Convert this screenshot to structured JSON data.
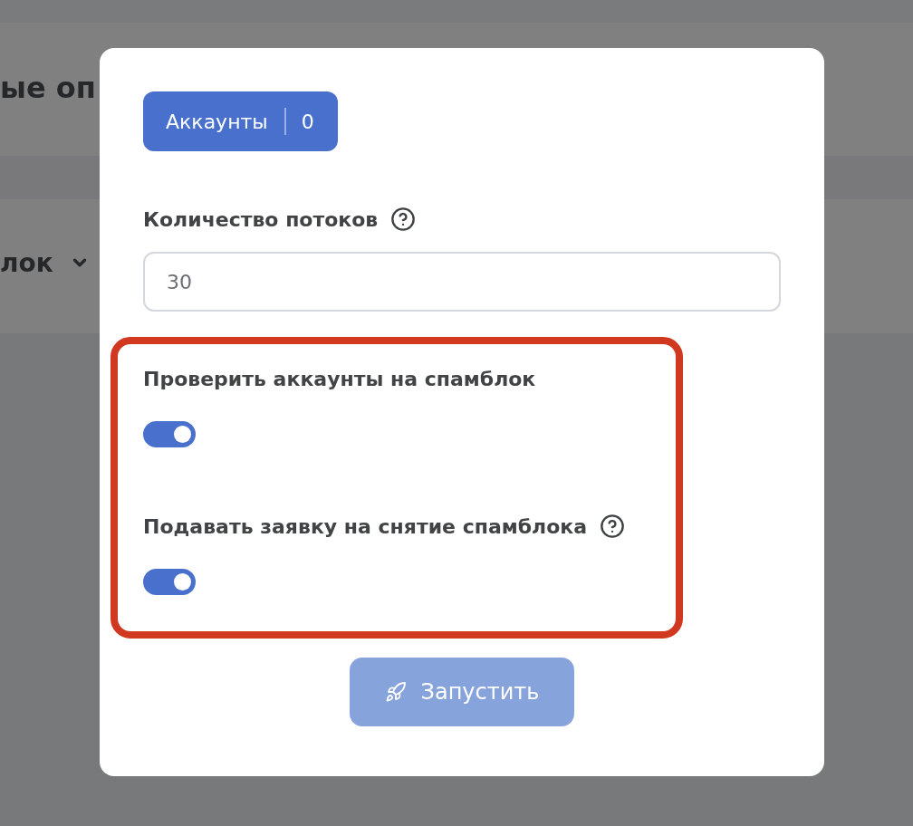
{
  "background": {
    "heading": "ые оп",
    "filter": {
      "label": "лок"
    }
  },
  "modal": {
    "accounts_button": {
      "label": "Аккаунты",
      "count": "0"
    },
    "threads": {
      "label": "Количество потоков",
      "help": true,
      "value": "30"
    },
    "options": [
      {
        "label": "Проверить аккаунты на спамблок",
        "help": false,
        "on": true
      },
      {
        "label": "Подавать заявку на снятие спамблока",
        "help": true,
        "on": true
      }
    ],
    "start_button": {
      "label": "Запустить",
      "disabled": true
    }
  }
}
